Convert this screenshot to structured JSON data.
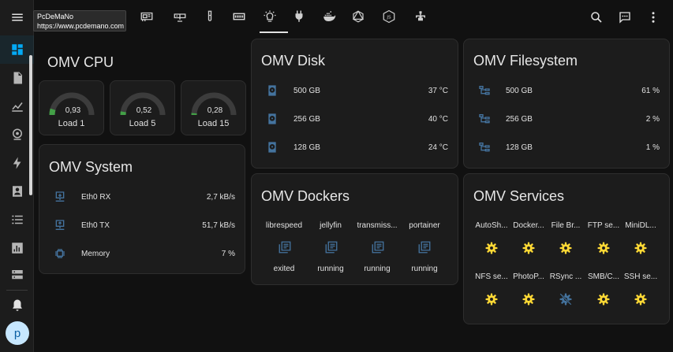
{
  "tooltip": {
    "line1": "PcDeMaNo",
    "line2": "https://www.pcdemano.com"
  },
  "cards": {
    "cpu": {
      "title": "OMV CPU",
      "gauges": [
        {
          "value": "0,93",
          "label": "Load 1",
          "fraction": 0.093
        },
        {
          "value": "0,52",
          "label": "Load 5",
          "fraction": 0.052
        },
        {
          "value": "0,28",
          "label": "Load 15",
          "fraction": 0.028
        }
      ]
    },
    "system": {
      "title": "OMV System",
      "rows": [
        {
          "label": "Eth0 RX",
          "value": "2,7 kB/s"
        },
        {
          "label": "Eth0 TX",
          "value": "51,7 kB/s"
        },
        {
          "label": "Memory",
          "value": "7 %"
        }
      ]
    },
    "disk": {
      "title": "OMV Disk",
      "rows": [
        {
          "label": "500 GB",
          "value": "37 °C"
        },
        {
          "label": "256 GB",
          "value": "40 °C"
        },
        {
          "label": "128 GB",
          "value": "24 °C"
        }
      ]
    },
    "filesystem": {
      "title": "OMV Filesystem",
      "rows": [
        {
          "label": "500 GB",
          "value": "61 %"
        },
        {
          "label": "256 GB",
          "value": "2 %"
        },
        {
          "label": "128 GB",
          "value": "1 %"
        }
      ]
    },
    "dockers": {
      "title": "OMV Dockers",
      "items": [
        {
          "name": "librespeed",
          "state": "exited"
        },
        {
          "name": "jellyfin",
          "state": "running"
        },
        {
          "name": "transmiss...",
          "state": "running"
        },
        {
          "name": "portainer",
          "state": "running"
        }
      ]
    },
    "services": {
      "title": "OMV Services",
      "row1": [
        "AutoSh...",
        "Docker...",
        "File Br...",
        "FTP se...",
        "MiniDL..."
      ],
      "row2": [
        "NFS se...",
        "PhotoP...",
        "RSync ...",
        "SMB/C...",
        "SSH se..."
      ]
    }
  },
  "avatar": "p",
  "colors": {
    "accent": "#03a9f4",
    "gauge_green": "#43a047",
    "service_on": "#fdd835",
    "service_off": "#44739e"
  }
}
